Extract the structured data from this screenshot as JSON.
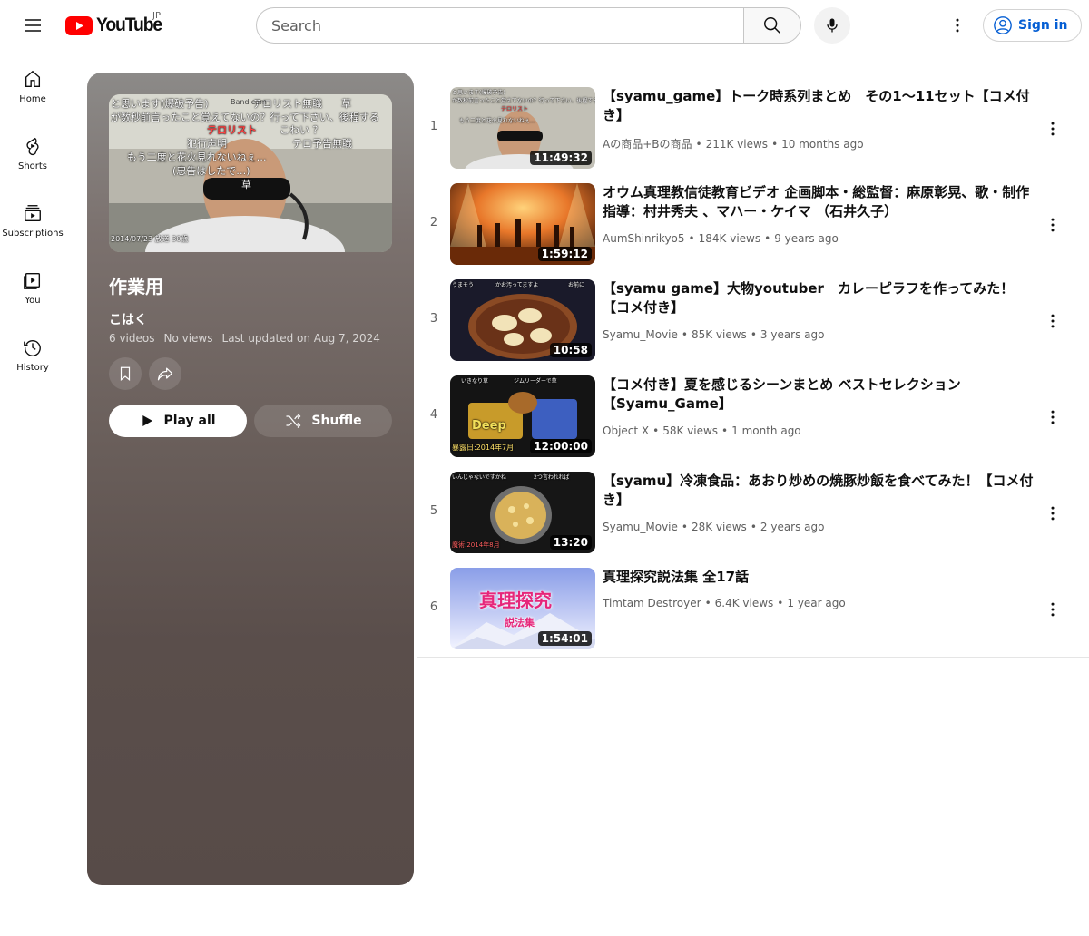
{
  "header": {
    "logo_text": "YouTube",
    "region": "JP",
    "search_placeholder": "Search",
    "signin_label": "Sign in",
    "brand_color": "#ff0000",
    "link_color": "#065fd4"
  },
  "guide": {
    "items": [
      {
        "label": "Home",
        "icon": "home-icon"
      },
      {
        "label": "Shorts",
        "icon": "shorts-icon"
      },
      {
        "label": "Subscriptions",
        "icon": "subscriptions-icon"
      },
      {
        "label": "You",
        "icon": "you-icon"
      },
      {
        "label": "History",
        "icon": "history-icon"
      }
    ]
  },
  "playlist": {
    "title": "作業用",
    "owner": "こはく",
    "video_count": "6 videos",
    "views": "No views",
    "last_updated": "Last updated on Aug 7, 2024",
    "play_all_label": "Play all",
    "shuffle_label": "Shuffle",
    "thumb_captions": [
      "と思います(爆破予告)",
      "テロリスト無職",
      "草",
      "が数秒前言ったこと覚えてないの？行って下さい、後程する",
      "テロリスト",
      "こわい ？",
      "犯行声明",
      "テロ予告無職",
      "もう二度と花火見れないねぇ…",
      "(忠告はしたで…)",
      "草",
      "2014/07/23 放送 30歳",
      "Bandicam"
    ]
  },
  "videos": [
    {
      "index": "1",
      "title": "【syamu_game】トーク時系列まとめ　その1〜11セット【コメ付き】",
      "channel": "Aの商品+Bの商品",
      "views": "211K views",
      "age": "10 months ago",
      "duration": "11:49:32"
    },
    {
      "index": "2",
      "title": "オウム真理教信徒教育ビデオ 企画脚本・総監督：麻原彰晃、歌・制作指導：村井秀夫 、マハー・ケイマ （石井久子）",
      "channel": "AumShinrikyo5",
      "views": "184K views",
      "age": "9 years ago",
      "duration": "1:59:12"
    },
    {
      "index": "3",
      "title": "【syamu game】大物youtuber　カレーピラフを作ってみた！【コメ付き】",
      "channel": "Syamu_Movie",
      "views": "85K views",
      "age": "3 years ago",
      "duration": "10:58"
    },
    {
      "index": "4",
      "title": "【コメ付き】夏を感じるシーンまとめ ベストセレクション【Syamu_Game】",
      "channel": "Object X",
      "views": "58K views",
      "age": "1 month ago",
      "duration": "12:00:00"
    },
    {
      "index": "5",
      "title": "【syamu】冷凍食品：あおり炒めの焼豚炒飯を食べてみた！【コメ付き】",
      "channel": "Syamu_Movie",
      "views": "28K views",
      "age": "2 years ago",
      "duration": "13:20"
    },
    {
      "index": "6",
      "title": "真理探究説法集 全17話",
      "channel": "Timtam Destroyer",
      "views": "6.4K views",
      "age": "1 year ago",
      "duration": "1:54:01"
    }
  ],
  "thumb_texts": {
    "v3": [
      "かお汚ってますよ",
      "うまそう",
      "お前に"
    ],
    "v4": [
      "Deep",
      "暴露日:2014年7月",
      "いきなり草",
      "ジムリーダーで草"
    ],
    "v5": [
      "いんじゃないですかね",
      "2つ言われれば",
      "魔術:2014年8月"
    ],
    "v6": [
      "真理探究",
      "説法集"
    ]
  }
}
